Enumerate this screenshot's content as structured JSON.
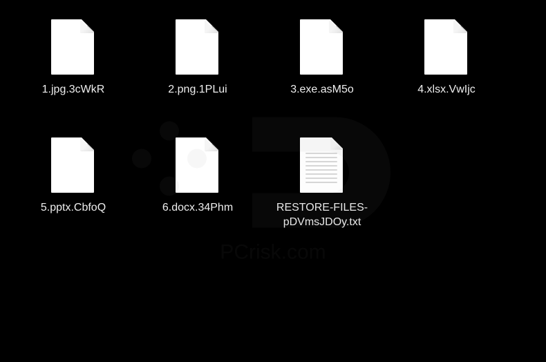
{
  "files": [
    {
      "name": "1.jpg.3cWkR",
      "type": "blank"
    },
    {
      "name": "2.png.1PLui",
      "type": "blank"
    },
    {
      "name": "3.exe.asM5o",
      "type": "blank"
    },
    {
      "name": "4.xlsx.VwIjc",
      "type": "blank"
    },
    {
      "name": "5.pptx.CbfoQ",
      "type": "blank"
    },
    {
      "name": "6.docx.34Phm",
      "type": "blank"
    },
    {
      "name": "RESTORE-FILES-pDVmsJDOy.txt",
      "type": "txt"
    }
  ],
  "watermark": {
    "text": "PCrisk.com"
  }
}
